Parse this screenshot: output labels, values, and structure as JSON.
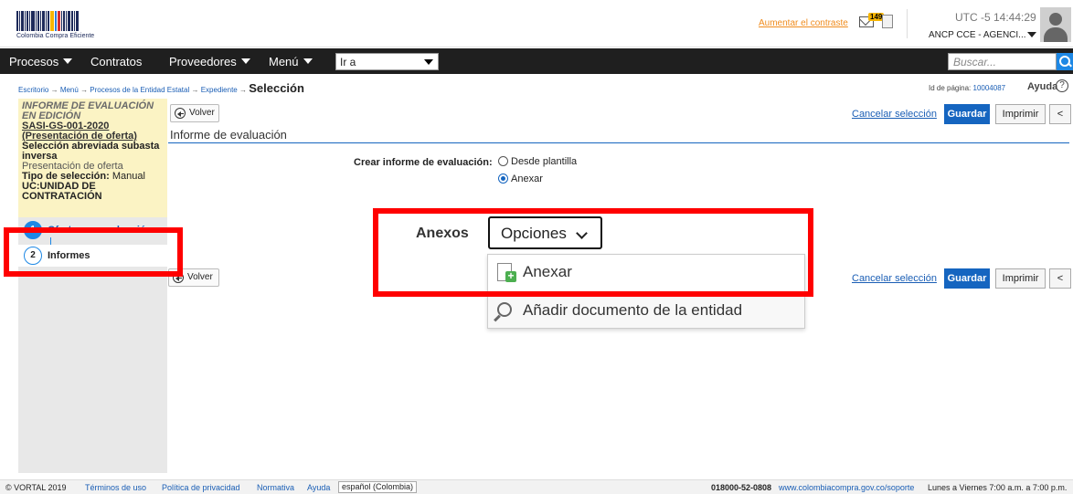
{
  "header": {
    "logo_caption": "Colombia Compra Eficiente",
    "contrast_link": "Aumentar el contraste",
    "mail_count": "149",
    "clock": "UTC -5 14:44:29",
    "user": "ANCP CCE - AGENCI..."
  },
  "nav": {
    "items": [
      "Procesos",
      "Contratos",
      "Proveedores",
      "Menú"
    ],
    "goto_value": "Ir a",
    "search_placeholder": "Buscar..."
  },
  "breadcrumb": {
    "items": [
      "Escritorio",
      "Menú",
      "Procesos de la Entidad Estatal",
      "Expediente"
    ],
    "separator": "→",
    "current": "Selección",
    "page_id_label": "Id de página:",
    "page_id": "10004087",
    "help": "Ayuda",
    "help_icon": "?"
  },
  "sidebar": {
    "status": "INFORME DE EVALUACIÓN EN EDICIÓN",
    "process_code": "SASI-GS-001-2020 (Presentación de oferta)",
    "modality": "Selección abreviada subasta inversa",
    "phase": "Presentación de oferta",
    "selection_type_label": "Tipo de selección:",
    "selection_type": "Manual",
    "uc": "UC:UNIDAD DE CONTRATACIÓN",
    "steps": [
      {
        "num": "1",
        "label": "Ofertas en evaluación"
      },
      {
        "num": "2",
        "label": "Informes"
      }
    ]
  },
  "toolbar": {
    "back": "Volver",
    "cancel": "Cancelar selección",
    "save": "Guardar",
    "print": "Imprimir",
    "prev": "<"
  },
  "content": {
    "section_title": "Informe de evaluación",
    "create_label": "Crear informe de evaluación:",
    "options": [
      "Desde plantilla",
      "Anexar"
    ],
    "selected_option": "Anexar",
    "anexos_label": "Anexos",
    "opciones_button": "Opciones",
    "dropdown": [
      "Anexar",
      "Añadir documento de la entidad"
    ]
  },
  "footer": {
    "copyright": "© VORTAL 2019",
    "links": [
      "Términos de uso",
      "Política de privacidad",
      "Normativa",
      "Ayuda"
    ],
    "language": "español (Colombia)",
    "phone": "018000-52-0808",
    "support_url": "www.colombiacompra.gov.co/soporte",
    "hours": "Lunes a Viernes 7:00 a.m. a 7:00 p.m."
  },
  "colors": {
    "nav_bg": "#1f1f1f",
    "primary": "#1565c0",
    "highlight": "#ff0000",
    "sidebar_info_bg": "#fbf3c4",
    "contrast_link": "#f08c1e"
  }
}
